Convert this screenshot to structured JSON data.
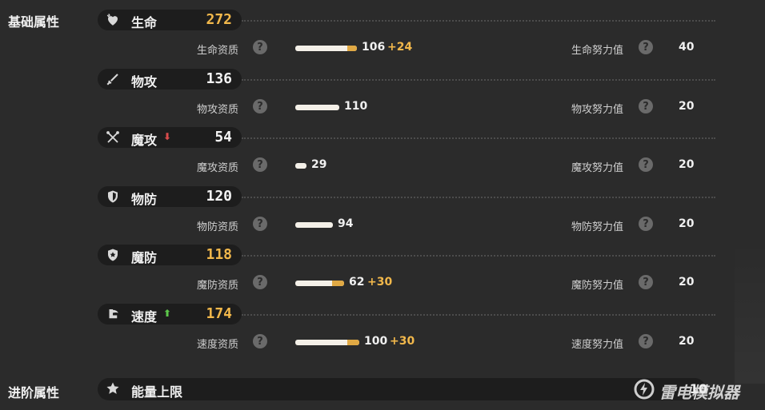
{
  "sections": {
    "basic": "基础属性",
    "advanced": "进阶属性"
  },
  "stats": [
    {
      "icon": "heart-icon",
      "name": "生命",
      "arrow": "",
      "value": "272",
      "value_color": "gold",
      "aptitude_label": "生命资质",
      "aptitude_value": "106",
      "aptitude_bonus": "+24",
      "aptitude_fraction": 0.65,
      "bonus_fraction": 0.12,
      "ev_label": "生命努力值",
      "ev_value": "40"
    },
    {
      "icon": "sword-icon",
      "name": "物攻",
      "arrow": "",
      "value": "136",
      "value_color": "white",
      "aptitude_label": "物攻资质",
      "aptitude_value": "110",
      "aptitude_bonus": "",
      "aptitude_fraction": 0.55,
      "bonus_fraction": 0,
      "ev_label": "物攻努力值",
      "ev_value": "20"
    },
    {
      "icon": "crossed-wands-icon",
      "name": "魔攻",
      "arrow": "down",
      "value": "54",
      "value_color": "white",
      "aptitude_label": "魔攻资质",
      "aptitude_value": "29",
      "aptitude_bonus": "",
      "aptitude_fraction": 0.14,
      "bonus_fraction": 0,
      "ev_label": "魔攻努力值",
      "ev_value": "20"
    },
    {
      "icon": "shield-icon",
      "name": "物防",
      "arrow": "",
      "value": "120",
      "value_color": "white",
      "aptitude_label": "物防资质",
      "aptitude_value": "94",
      "aptitude_bonus": "",
      "aptitude_fraction": 0.47,
      "bonus_fraction": 0,
      "ev_label": "物防努力值",
      "ev_value": "20"
    },
    {
      "icon": "magic-shield-icon",
      "name": "魔防",
      "arrow": "",
      "value": "118",
      "value_color": "gold",
      "aptitude_label": "魔防资质",
      "aptitude_value": "62",
      "aptitude_bonus": "+30",
      "aptitude_fraction": 0.46,
      "bonus_fraction": 0.15,
      "ev_label": "魔防努力值",
      "ev_value": "20"
    },
    {
      "icon": "wing-boot-icon",
      "name": "速度",
      "arrow": "up",
      "value": "174",
      "value_color": "gold",
      "aptitude_label": "速度资质",
      "aptitude_value": "100",
      "aptitude_bonus": "+30",
      "aptitude_fraction": 0.65,
      "bonus_fraction": 0.15,
      "ev_label": "速度努力值",
      "ev_value": "20"
    }
  ],
  "advanced": {
    "icon": "star-icon",
    "name": "能量上限",
    "value": "10"
  },
  "qmark_glyph": "?",
  "arrow_glyphs": {
    "down": "⬇",
    "up": "⬆"
  },
  "watermark": {
    "text": "雷电模拟器",
    "icon": "thunder-logo-icon"
  },
  "colors": {
    "gold": "#f2b84b",
    "white": "#f4f4f4",
    "bar_gold": "#e0a944",
    "bar_white": "#f4f0e8",
    "up": "#5cc84a",
    "down": "#d84b4b"
  }
}
